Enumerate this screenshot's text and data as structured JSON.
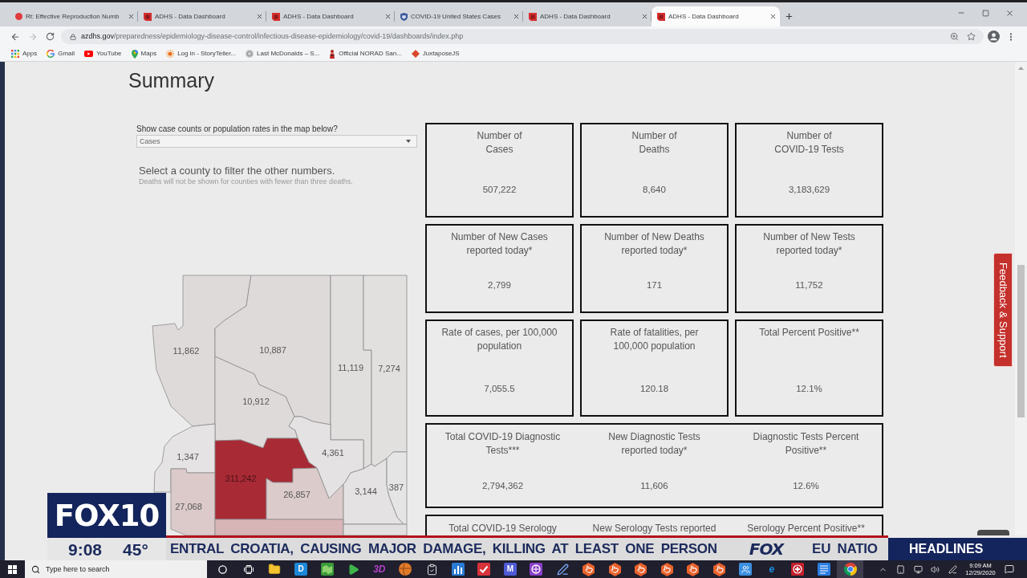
{
  "browser": {
    "tabs": [
      {
        "kind": "dot",
        "title": "Rt: Effective Reproduction Numb",
        "selected": false
      },
      {
        "kind": "adhs",
        "title": "ADHS - Data Dashboard",
        "selected": false
      },
      {
        "kind": "adhs",
        "title": "ADHS - Data Dashboard",
        "selected": false
      },
      {
        "kind": "shield",
        "title": "COVID-19 United States Cases",
        "selected": false
      },
      {
        "kind": "adhs",
        "title": "ADHS - Data Dashboard",
        "selected": false
      },
      {
        "kind": "adhs",
        "title": "ADHS - Data Dashboard",
        "selected": true
      }
    ],
    "nav": {
      "back_disabled": false,
      "forward_disabled": true
    },
    "address": {
      "host": "azdhs.gov",
      "path": "/preparedness/epidemiology-disease-control/infectious-disease-epidemiology/covid-19/dashboards/index.php"
    },
    "bookmarks": [
      {
        "kind": "apps",
        "label": "Apps"
      },
      {
        "kind": "google",
        "label": "Gmail"
      },
      {
        "kind": "youtube",
        "label": "YouTube"
      },
      {
        "kind": "maps",
        "label": "Maps"
      },
      {
        "kind": "storyteller",
        "label": "Log in - StoryTeller..."
      },
      {
        "kind": "emblem",
        "label": "Last McDonalds – S..."
      },
      {
        "kind": "figure",
        "label": "Official NORAD San..."
      },
      {
        "kind": "diamond",
        "label": "JuxtaposeJS"
      }
    ]
  },
  "page": {
    "heading": "Summary",
    "filter": {
      "label": "Show case counts or population rates in the map below?",
      "value": "Cases"
    },
    "instruction": "Select a county to filter the other numbers.",
    "note": "Deaths will not be shown for counties with fewer than three deaths.",
    "counties": [
      {
        "value": "11,862",
        "color": "#dfdada"
      },
      {
        "value": "10,887",
        "color": "#dfdada"
      },
      {
        "value": "11,119",
        "color": "#e1dede"
      },
      {
        "value": "7,274",
        "color": "#e2dfdf"
      },
      {
        "value": "10,912",
        "color": "#dfdada"
      },
      {
        "value": "1,347",
        "color": "#e5e3e3"
      },
      {
        "value": "4,361",
        "color": "#e4e2e2"
      },
      {
        "value": "27,068",
        "color": "#dccaca"
      },
      {
        "value": "311,242",
        "color": "#a82a35"
      },
      {
        "value": "26,857",
        "color": "#dccbcb"
      },
      {
        "value": "3,144",
        "color": "#e4e2e2"
      },
      {
        "value": "387",
        "color": "#e6e5e5"
      },
      {
        "color": "#d7b5b7"
      },
      {
        "color": "#e2dfdf"
      }
    ],
    "tile_rows": [
      {
        "kind": "boxes",
        "tiles": [
          {
            "label": "Number of\nCases",
            "value": "507,222"
          },
          {
            "label": "Number of\nDeaths",
            "value": "8,640"
          },
          {
            "label": "Number of\nCOVID-19 Tests",
            "value": "3,183,629"
          }
        ]
      },
      {
        "kind": "boxes",
        "tiles": [
          {
            "label": "Number of New Cases\nreported today*",
            "value": "2,799"
          },
          {
            "label": "Number of New Deaths\nreported today*",
            "value": "171"
          },
          {
            "label": "Number of New Tests\nreported today*",
            "value": "11,752"
          }
        ]
      },
      {
        "kind": "boxes",
        "tiles": [
          {
            "label": "Rate of cases, per 100,000\npopulation",
            "value": "7,055.5"
          },
          {
            "label": "Rate of fatalities, per\n100,000 population",
            "value": "120.18"
          },
          {
            "label": "Total Percent Positive**",
            "value": "12.1%"
          }
        ]
      },
      {
        "kind": "panel",
        "tiles": [
          {
            "label": "Total COVID-19 Diagnostic\nTests***",
            "value": "2,794,362"
          },
          {
            "label": "New Diagnostic Tests\nreported today*",
            "value": "11,606"
          },
          {
            "label": "Diagnostic Tests Percent\nPositive**",
            "value": "12.6%"
          }
        ]
      },
      {
        "kind": "panel",
        "tiles": [
          {
            "label": "Total COVID-19 Serology"
          },
          {
            "label": "New Serology Tests reported"
          },
          {
            "label": "Serology Percent Positive**"
          }
        ]
      }
    ],
    "feedback": "Feedback & Support"
  },
  "overlay": {
    "station": "FOX10",
    "time": "9:08",
    "temperature": "45°",
    "ticker": {
      "headline": "ENTRAL CROATIA, CAUSING MAJOR DAMAGE, KILLING AT LEAST ONE PERSON",
      "logo": "FOX",
      "next": "EU NATIO"
    },
    "section": "HEADLINES"
  },
  "taskbar": {
    "search_placeholder": "Type here to search",
    "apps": [
      {
        "kind": "folder",
        "selected": false
      },
      {
        "kind": "lettertile",
        "label": "D",
        "color": "#1e88d8",
        "selected": false
      },
      {
        "kind": "map",
        "selected": false
      },
      {
        "kind": "play",
        "selected": false
      },
      {
        "kind": "lettermark",
        "label": "3D",
        "color": "#b440c8",
        "selected": false
      },
      {
        "kind": "ball",
        "selected": false
      },
      {
        "kind": "clipboard",
        "selected": false
      },
      {
        "kind": "chart",
        "selected": false
      },
      {
        "kind": "checkmark",
        "selected": false
      },
      {
        "kind": "lettertile",
        "label": "M",
        "color": "#4f5bd5",
        "selected": false
      },
      {
        "kind": "compass",
        "selected": false
      },
      {
        "kind": "pen",
        "selected": false
      },
      {
        "kind": "hand",
        "selected": false
      },
      {
        "kind": "hand",
        "selected": false
      },
      {
        "kind": "hand",
        "selected": false
      },
      {
        "kind": "hand",
        "selected": false
      },
      {
        "kind": "hand",
        "selected": false
      },
      {
        "kind": "hand",
        "selected": false
      },
      {
        "kind": "people",
        "selected": false
      },
      {
        "kind": "lettermark",
        "label": "e",
        "color": "#1a8fe3",
        "selected": false
      },
      {
        "kind": "firstaid",
        "selected": false
      },
      {
        "kind": "notes",
        "selected": false
      },
      {
        "kind": "chrome",
        "selected": true
      }
    ],
    "time": "9:09 AM",
    "date": "12/29/2020"
  }
}
